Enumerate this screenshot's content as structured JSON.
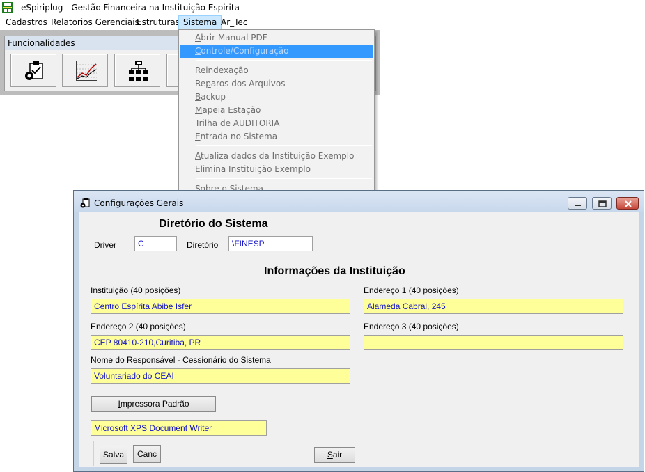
{
  "app": {
    "title": "eSpiriplug - Gestão Financeira na Instituição Espirita"
  },
  "menubar": {
    "items": [
      {
        "label": "Cadastros"
      },
      {
        "label": "Relatorios Gerenciais"
      },
      {
        "label": "Estruturas"
      },
      {
        "label": "Sistema"
      },
      {
        "label": "Ar_Tec"
      }
    ]
  },
  "toolbar": {
    "title": "Funcionalidades"
  },
  "sistema_menu": {
    "items": [
      {
        "accel": "A",
        "rest": "brir Manual PDF"
      },
      {
        "accel": "C",
        "rest": "ontrole/Configuração"
      },
      {
        "accel": "R",
        "rest": "eindexação"
      },
      {
        "pre": "Re",
        "accel": "p",
        "rest": "aros dos Arquivos"
      },
      {
        "accel": "B",
        "rest": "ackup"
      },
      {
        "accel": "M",
        "rest": "apeia Estação"
      },
      {
        "accel": "T",
        "rest": "rilha de AUDITORIA"
      },
      {
        "accel": "E",
        "rest": "ntrada no Sistema"
      },
      {
        "accel": "A",
        "rest": "tualiza dados da Instituição Exemplo"
      },
      {
        "accel": "E",
        "rest": "limina Instituição Exemplo"
      },
      {
        "accel": "S",
        "rest": "obre o Sistema"
      }
    ]
  },
  "dialog": {
    "title": "Configurações Gerais",
    "section_dir": "Diretório do Sistema",
    "driver_label": "Driver",
    "driver_value": "C",
    "dir_label": "Diretório",
    "dir_value": "\\FINESP",
    "section_inst": "Informações da Instituição",
    "inst_label": "Instituição (40 posições)",
    "inst_value": "Centro Espírita Abibe Isfer",
    "end1_label": "Endereço 1 (40 posições)",
    "end1_value": "Alameda Cabral, 245",
    "end2_label": "Endereço 2 (40 posições)",
    "end2_value": "CEP 80410-210,Curitiba, PR",
    "end3_label": "Endereço 3 (40 posições)",
    "end3_value": "",
    "resp_label": "Nome do Responsável - Cessionário do Sistema",
    "resp_value": "Voluntariado do CEAI",
    "printer_btn_accel": "I",
    "printer_btn_rest": "mpressora Padrão",
    "printer_value": "Microsoft XPS Document Writer",
    "save_label": "Salva",
    "cancel_label": "Canc",
    "exit_accel": "S",
    "exit_rest": "air"
  }
}
